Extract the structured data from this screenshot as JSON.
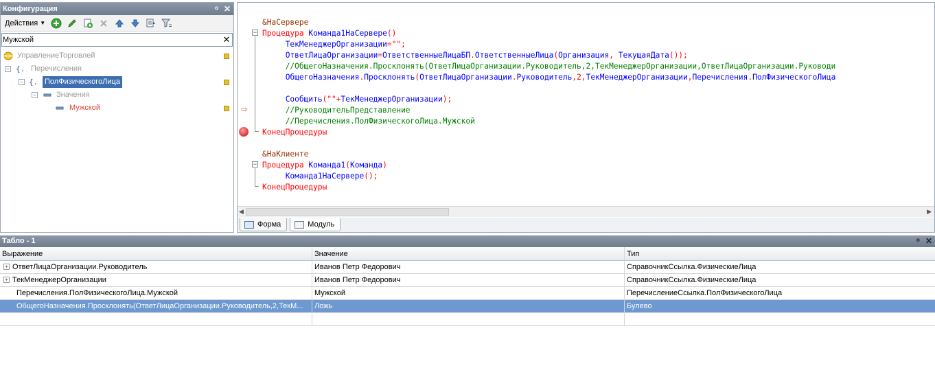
{
  "config_panel": {
    "title": "Конфигурация",
    "pin_glyph": "ᵒ",
    "close_glyph": "✕",
    "actions_label": "Действия",
    "filter_value": "Мужской",
    "clear_glyph": "✕",
    "tree": [
      {
        "label": "УправлениеТорговлей",
        "level": 0
      },
      {
        "label": "Перечисления",
        "level": 1
      },
      {
        "label": "ПолФизическогоЛица",
        "level": 2
      },
      {
        "label": "Значения",
        "level": 3
      },
      {
        "label": "Мужской",
        "level": 4
      }
    ]
  },
  "editor": {
    "lines": {
      "l1": "&НаСервере",
      "l2_kw": "Процедура",
      "l2_name": " Команда1НаСервере",
      "l2_paren": "()",
      "l3": "ТекМенеджерОрганизации",
      "l3_rest": "=\"\";",
      "l4_a": "ОтветЛицаОрганизации",
      "l4_b": "=",
      "l4_c": "ОтветственныеЛицаБП",
      "l4_d": ".",
      "l4_e": "ОтветственныеЛица",
      "l4_f": "(",
      "l4_g": "Организация",
      "l4_h": ", ",
      "l4_i": "ТекущаяДата",
      "l4_j": "());",
      "l5": "//ОбщегоНазначения.Просклонять(ОтветЛицаОрганизации.Руководитель,2,ТекМенеджерОрганизации,ОтветЛицаОрганизации.Руководи",
      "l6_a": "ОбщегоНазначения",
      "l6_b": ".",
      "l6_c": "Просклонять",
      "l6_d": "(",
      "l6_e": "ОтветЛицаОрганизации",
      "l6_f": ".",
      "l6_g": "Руководитель",
      "l6_h": ",2,",
      "l6_i": "ТекМенеджерОрганизации",
      "l6_j": ",",
      "l6_k": "Перечисления",
      "l6_l": ".",
      "l6_m": "ПолФизическогоЛица",
      "l8_a": "Сообщить",
      "l8_b": "(\"\"+",
      "l8_c": "ТекМенеджерОрганизации",
      "l8_d": ");",
      "l9": "//РуководительПредставление",
      "l10": "//Перечисления.ПолФизическогоЛица.Мужской",
      "l11": "КонецПроцедуры",
      "l13": "&НаКлиенте",
      "l14_kw": "Процедура",
      "l14_name": " Команда1",
      "l14_a": "(",
      "l14_b": "Команда",
      "l14_c": ")",
      "l15_a": "Команда1НаСервере",
      "l15_b": "();",
      "l16": "КонецПроцедуры"
    },
    "tabs": [
      {
        "label": "Форма"
      },
      {
        "label": "Модуль"
      }
    ]
  },
  "tablo": {
    "title": "Табло - 1",
    "pin_glyph": "ᵒ",
    "close_glyph": "✕",
    "columns": [
      "Выражение",
      "Значение",
      "Тип"
    ],
    "rows": [
      {
        "expr": "ОтветЛицаОрганизации.Руководитель",
        "value": "Иванов Петр Федорович",
        "type": "СправочникСсылка.ФизическиеЛица",
        "expandable": true
      },
      {
        "expr": "ТекМенеджерОрганизации",
        "value": "Иванов Петр Федорович",
        "type": "СправочникСсылка.ФизическиеЛица",
        "expandable": true
      },
      {
        "expr": "Перечисления.ПолФизическогоЛица.Мужской",
        "value": "Мужской",
        "type": "ПеречислениеСсылка.ПолФизическогоЛица",
        "expandable": false
      },
      {
        "expr": "ОбщегоНазначения.Просклонять(ОтветЛицаОрганизации.Руководитель,2,ТекМ...",
        "value": "Ложь",
        "type": "Булево",
        "expandable": false,
        "selected": true
      }
    ]
  },
  "colors": {
    "keyword": "#ff0000",
    "identifier": "#0000ff",
    "comment": "#008000",
    "preprocessor": "#963200",
    "selection": "#6d98d0"
  }
}
